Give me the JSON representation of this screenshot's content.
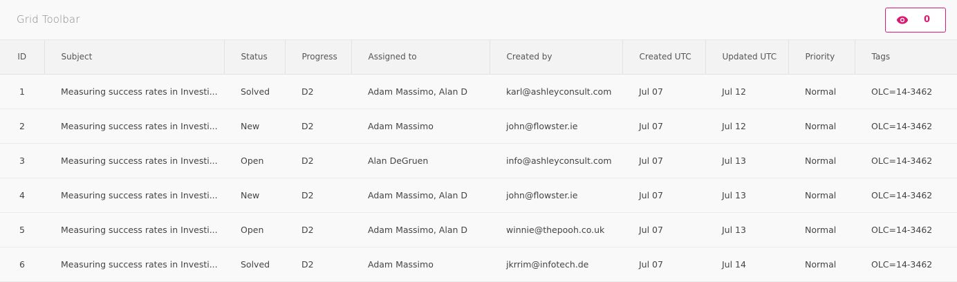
{
  "toolbar": {
    "title": "Grid Toolbar",
    "visibility_count": "0",
    "accent_color": "#d81b72",
    "button_icon": "eye-icon"
  },
  "grid": {
    "columns": [
      "ID",
      "Subject",
      "Status",
      "Progress",
      "Assigned to",
      "Created by",
      "Created UTC",
      "Updated UTC",
      "Priority",
      "Tags"
    ],
    "rows": [
      {
        "id": "1",
        "subject": "Measuring success rates in Investi...",
        "status": "Solved",
        "progress": "D2",
        "assigned": "Adam Massimo, Alan D",
        "created_by": "karl@ashleyconsult.com",
        "created_utc": "Jul 07",
        "updated_utc": "Jul 12",
        "priority": "Normal",
        "tags": "OLC=14-3462"
      },
      {
        "id": "2",
        "subject": "Measuring success rates in Investi...",
        "status": "New",
        "progress": "D2",
        "assigned": "Adam Massimo",
        "created_by": "john@flowster.ie",
        "created_utc": "Jul 07",
        "updated_utc": "Jul 12",
        "priority": "Normal",
        "tags": "OLC=14-3462"
      },
      {
        "id": "3",
        "subject": "Measuring success rates in Investi...",
        "status": "Open",
        "progress": "D2",
        "assigned": "Alan DeGruen",
        "created_by": "info@ashleyconsult.com",
        "created_utc": "Jul 07",
        "updated_utc": "Jul 13",
        "priority": "Normal",
        "tags": "OLC=14-3462"
      },
      {
        "id": "4",
        "subject": "Measuring success rates in Investi...",
        "status": "New",
        "progress": "D2",
        "assigned": "Adam Massimo, Alan D",
        "created_by": "john@flowster.ie",
        "created_utc": "Jul 07",
        "updated_utc": "Jul 13",
        "priority": "Normal",
        "tags": "OLC=14-3462"
      },
      {
        "id": "5",
        "subject": "Measuring success rates in Investi...",
        "status": "Open",
        "progress": "D2",
        "assigned": "Adam Massimo, Alan D",
        "created_by": "winnie@thepooh.co.uk",
        "created_utc": "Jul 07",
        "updated_utc": "Jul 13",
        "priority": "Normal",
        "tags": "OLC=14-3462"
      },
      {
        "id": "6",
        "subject": "Measuring success rates in Investi...",
        "status": "Solved",
        "progress": "D2",
        "assigned": "Adam Massimo",
        "created_by": "jkrrim@infotech.de",
        "created_utc": "Jul 07",
        "updated_utc": "Jul 14",
        "priority": "Normal",
        "tags": "OLC=14-3462"
      }
    ]
  }
}
